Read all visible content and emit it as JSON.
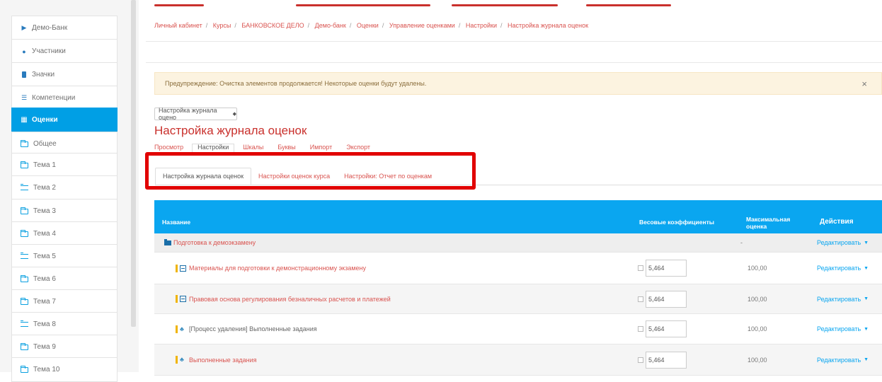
{
  "sidebar": {
    "items": [
      {
        "label": "Демо-Банк",
        "icon": "bank-icon",
        "active": false
      },
      {
        "label": "Участники",
        "icon": "users-icon",
        "active": false
      },
      {
        "label": "Значки",
        "icon": "badge-icon",
        "active": false
      },
      {
        "label": "Компетенции",
        "icon": "competency-icon",
        "active": false
      },
      {
        "label": "Оценки",
        "icon": "grades-icon",
        "active": true
      },
      {
        "label": "Общее",
        "icon": "folder-icon",
        "active": false
      },
      {
        "label": "Тема 1",
        "icon": "folder-icon",
        "active": false
      },
      {
        "label": "Тема 2",
        "icon": "folder-open-icon",
        "active": false
      },
      {
        "label": "Тема 3",
        "icon": "folder-icon",
        "active": false
      },
      {
        "label": "Тема 4",
        "icon": "folder-icon",
        "active": false
      },
      {
        "label": "Тема 5",
        "icon": "folder-open-icon",
        "active": false
      },
      {
        "label": "Тема 6",
        "icon": "folder-icon",
        "active": false
      },
      {
        "label": "Тема 7",
        "icon": "folder-icon",
        "active": false
      },
      {
        "label": "Тема 8",
        "icon": "folder-open-icon",
        "active": false
      },
      {
        "label": "Тема 9",
        "icon": "folder-icon",
        "active": false
      },
      {
        "label": "Тема 10",
        "icon": "folder-icon",
        "active": false
      }
    ]
  },
  "breadcrumb": [
    "Личный кабинет",
    "Курсы",
    "БАНКОВСКОЕ ДЕЛО",
    "Демо-банк",
    "Оценки",
    "Управление оценками",
    "Настройки",
    "Настройка журнала оценок"
  ],
  "alert": {
    "text": "Предупреждение: Очистка элементов продолжается! Некоторые оценки будут удалены.",
    "close": "×"
  },
  "select": {
    "value": "Настройка журнала оцено",
    "caret": "◆"
  },
  "page_title": "Настройка журнала оценок",
  "tabs_primary": [
    "Просмотр",
    "Настройки",
    "Шкалы",
    "Буквы",
    "Импорт",
    "Экспорт"
  ],
  "tabs_secondary": [
    "Настройка журнала оценок",
    "Настройки оценок курса",
    "Настройки: Отчет по оценкам"
  ],
  "table": {
    "headers": {
      "name": "Название",
      "weight": "Весовые коэффициенты",
      "max_line1": "Максимальная",
      "max_line2": "оценка",
      "actions": "Действия"
    },
    "category": {
      "name": "Подготовка к демоэкзамену",
      "max": "-",
      "action": "Редактировать"
    },
    "rows": [
      {
        "name": "Материалы для подготовки к демонстрационному экзамену",
        "weight": "5,464",
        "max": "100,00",
        "action": "Редактировать"
      },
      {
        "name": "Правовая основа регулирования безналичных расчетов и платежей",
        "weight": "5,464",
        "max": "100,00",
        "action": "Редактировать"
      },
      {
        "name": "[Процесс удаления] Выполненные задания",
        "weight": "5,464",
        "max": "100,00",
        "action": "Редактировать"
      },
      {
        "name": "Выполненные задания",
        "weight": "5,464",
        "max": "100,00",
        "action": "Редактировать"
      }
    ]
  },
  "colors": {
    "accent": "#0aa6f0",
    "link": "#d9534f",
    "title": "#c9302c",
    "highlight_box": "#e10000",
    "alert_bg": "#fcf3e0"
  }
}
